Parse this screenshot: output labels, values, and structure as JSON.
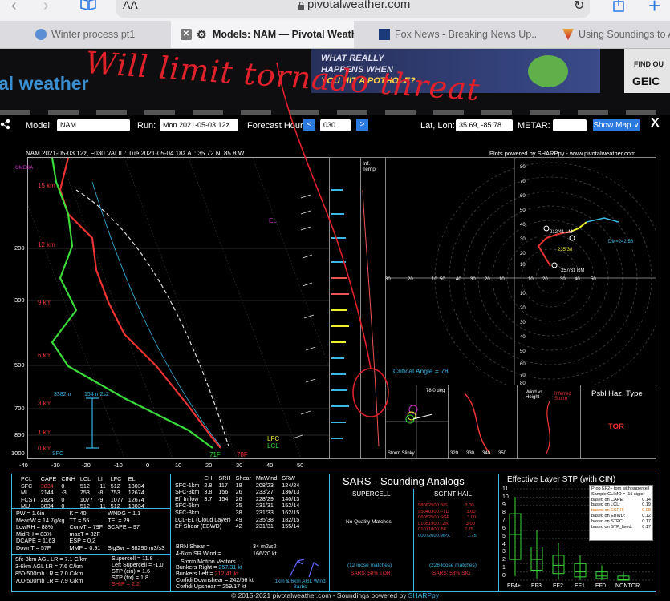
{
  "browser": {
    "aa_label": "AA",
    "url": "pivotalweather.com",
    "tabs": [
      {
        "label": "Winter process pt1"
      },
      {
        "label": "Models: NAM — Pivotal Weather"
      },
      {
        "label": "Fox News - Breaking News Up..."
      },
      {
        "label": "Using Soundings to Ar"
      }
    ]
  },
  "site": {
    "logo_text": "al weather",
    "ad_line1": "WHAT REALLY",
    "ad_line2": "HAPPENS WHEN",
    "ad_line3": "YOU HIT A POTHOLE?",
    "ad2_text1": "FIND OU",
    "ad2_text2": "GEIC"
  },
  "annotation": {
    "text": "Will limit tornado threat"
  },
  "controls": {
    "model_label": "Model:",
    "model_value": "NAM",
    "run_label": "Run:",
    "run_value": "Mon 2021-05-03 12z",
    "forecast_label": "Forecast Hour:",
    "forecast_value": "030",
    "prev": "<",
    "next": ">",
    "latlon_label": "Lat, Lon:",
    "latlon_value": "35.69, -85.78",
    "metar_label": "METAR:",
    "metar_value": "",
    "show_map": "Show Map ∨",
    "close": "X"
  },
  "sounding": {
    "title": "NAM 2021-05-03 12z, F030  VALID: Tue 2021-05-04 18z  AT: 35.72 N, 85.8 W",
    "credit": "Plots powered by SHARPpy - www.pivotalweather.com",
    "omega": "OMEGA",
    "inf_temp": "Inf. Temp.",
    "el": "EL",
    "lfc": "LFC",
    "lcl": "LCL",
    "sfc": "SFC",
    "t_sfc": "71F",
    "td_sfc": "78F",
    "el_hgt": "3382m",
    "srh_label": "154 m2s2",
    "heights": [
      "15 km",
      "12 km",
      "9 km",
      "6 km",
      "3 km",
      "1 km",
      "0 km"
    ],
    "pressures": [
      "200",
      "300",
      "500",
      "700",
      "850",
      "1000"
    ],
    "temps": [
      "-40",
      "-30",
      "-20",
      "-10",
      "0",
      "10",
      "20",
      "30",
      "40",
      "50"
    ],
    "critical_angle": "Critical Angle = 78",
    "slinky": "Storm Slinky",
    "slinky_deg": "78.0 deg",
    "theta_ticks": [
      "320",
      "330",
      "340",
      "350"
    ],
    "hodo_rings": [
      "80",
      "70",
      "60",
      "50",
      "40",
      "30",
      "20",
      "10",
      "10",
      "20",
      "30",
      "40",
      "50",
      "60",
      "70",
      "80"
    ],
    "hodo_x": [
      "30",
      "20",
      "10",
      "50",
      "40",
      "30",
      "20",
      "10",
      "10",
      "20",
      "30",
      "40",
      "50"
    ],
    "hodo_labels": {
      "dm": "DM=242/56",
      "rm": "257/31 RM",
      "lm": "235/38",
      "a": "212/41 LM"
    },
    "psbl_haz": "Psbl Haz. Type",
    "haz_type": "TOR",
    "wind_height": "Wind vs Height",
    "inferred": "Inferred Storm",
    "copyright": "© 2015-2021 pivotalweather.com - Soundings powered by",
    "sharppy": "SHARPpy"
  },
  "parcel_table": {
    "header": [
      "PCL",
      "CAPE",
      "CINH",
      "LCL",
      "LI",
      "LFC",
      "EL"
    ],
    "rows": [
      [
        "SFC",
        "3834",
        "0",
        "512",
        "-11",
        "512",
        "13034"
      ],
      [
        "ML",
        "2144",
        "-3",
        "753",
        "-8",
        "753",
        "12674"
      ],
      [
        "FCST",
        "2824",
        "0",
        "1077",
        "-9",
        "1077",
        "12674"
      ],
      [
        "MU",
        "3834",
        "0",
        "512",
        "-11",
        "512",
        "13034"
      ]
    ]
  },
  "indices_left": [
    [
      "PW = 1.6in",
      "K = 40",
      "WNDG = 1.1"
    ],
    [
      "MeanW = 14.7g/kg",
      "TT = 55",
      "TEI = 29"
    ],
    [
      "LowRH = 88%",
      "ConvT = 79F",
      "3CAPE = 97"
    ],
    [
      "MidRH = 83%",
      "maxT = 82F",
      ""
    ],
    [
      "DCAPE = 1163",
      "ESP = 0.2",
      ""
    ],
    [
      "DownT = 57F",
      "MMP = 0.91",
      "SigSvr = 38290 m3/s3"
    ]
  ],
  "lapse": [
    "Sfc-3km AGL LR = 7.1 C/km",
    "3-6km AGL LR = 7.6 C/km",
    "850-500mb LR = 7.0 C/km",
    "700-500mb LR = 7.9 C/km"
  ],
  "comp": [
    [
      "Supercell = 11.8"
    ],
    [
      "Left Supercell = -1.0"
    ],
    [
      "STP (cin) = 1.6"
    ],
    [
      "STP (fix) = 1.8"
    ],
    [
      "SHIP = 2.2"
    ]
  ],
  "kinematic": {
    "header": [
      "",
      "EHI",
      "SRH",
      "Shear",
      "MnWind",
      "SRW"
    ],
    "rows": [
      [
        "SFC-1km",
        "2.8",
        "117",
        "18",
        "208/23",
        "124/24"
      ],
      [
        "SFC-3km",
        "3.8",
        "156",
        "26",
        "233/27",
        "136/13"
      ],
      [
        "Eff Inflow",
        "3.7",
        "154",
        "26",
        "228/29",
        "140/13"
      ],
      [
        "",
        "",
        "",
        "",
        "",
        ""
      ],
      [
        "SFC-6km",
        "",
        "",
        "35",
        "231/31",
        "152/14"
      ],
      [
        "SFC-8km",
        "",
        "",
        "38",
        "231/33",
        "162/15"
      ],
      [
        "LCL-EL (Cloud Layer)",
        "",
        "",
        "49",
        "235/38",
        "182/15"
      ],
      [
        "Eff Shear (EBWD)",
        "",
        "",
        "42",
        "231/31",
        "155/14"
      ]
    ],
    "brn": "BRN Shear =",
    "brn_val": "34 m2/s2",
    "sr46": "4-6km SR Wind =",
    "sr46_val": "166/20 kt",
    "motion_title": "...Storm Motion Vectors...",
    "motions": [
      [
        "Bunkers Right =",
        "257/31 kt"
      ],
      [
        "Bunkers Left =",
        "212/41 kt"
      ],
      [
        "Corfidi Downshear =",
        "242/56 kt"
      ],
      [
        "Corfidi Upshear =",
        "259/17 kt"
      ]
    ],
    "barb_caption": "1km & 6km AGL Wind Barbs"
  },
  "sars": {
    "title": "SARS - Sounding Analogs",
    "supercell": "SUPERCELL",
    "hail": "SGFNT HAIL",
    "no_match": "No Quality Matches",
    "hail_list": [
      [
        "98062500.BIS",
        "3.00"
      ],
      [
        "95040300.FTD",
        "3.00"
      ],
      [
        "06052500.SGF",
        "3.00"
      ],
      [
        "01051900.LZK",
        "3.00"
      ],
      [
        "01071800.INL",
        "2.75"
      ],
      [
        "00072600.MPX",
        "1.75"
      ]
    ],
    "loose1": "(12 loose matches)",
    "loose2": "(226 loose matches)",
    "tor_pct": "SARS: 58% TOR",
    "sig_pct": "SARS: 58% SIG"
  },
  "stp": {
    "title": "Effective Layer STP (with CIN)",
    "legend_title": "Prob EF2+ torn with supercell",
    "legend_sub": "Sample CLIMO = .15 sigtor",
    "legend": [
      [
        "based on CAPE:",
        "0.14"
      ],
      [
        "based on LCL:",
        "0.19"
      ],
      [
        "based on ESRH:",
        "0.08"
      ],
      [
        "based on EBWD:",
        "0.12"
      ],
      [
        "based on STPC:",
        "0.17"
      ],
      [
        "based on STP_fixed:",
        "0.17"
      ]
    ],
    "y_ticks": [
      "11",
      "10",
      "9",
      "8",
      "7",
      "6",
      "5",
      "4",
      "3",
      "2",
      "1",
      "0"
    ],
    "categories": [
      "EF4+",
      "EF3",
      "EF2",
      "EF1",
      "EF0",
      "NONTOR"
    ]
  }
}
